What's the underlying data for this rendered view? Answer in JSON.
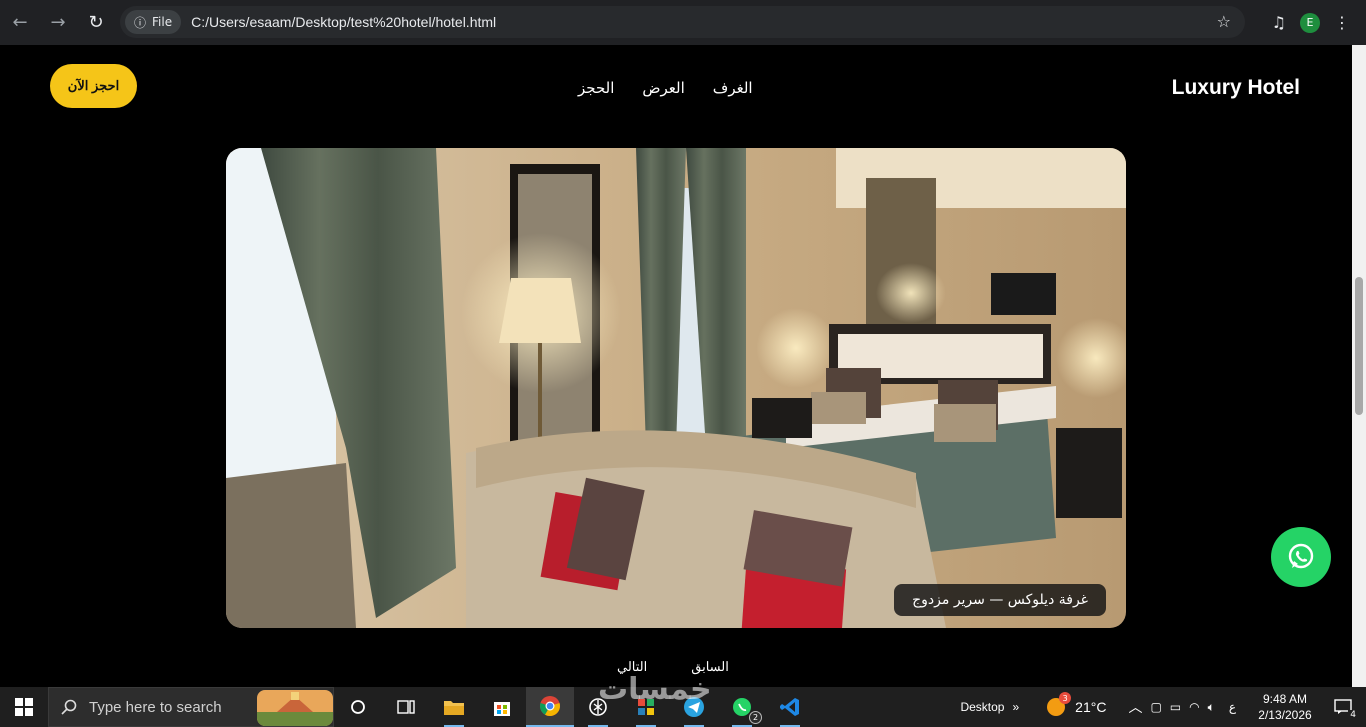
{
  "browser": {
    "site_chip": "File",
    "url": "C:/Users/esaam/Desktop/test%20hotel/hotel.html",
    "profile_initial": "E"
  },
  "site": {
    "logo": "Luxury Hotel",
    "nav": [
      "الغرف",
      "العرض",
      "الحجز"
    ],
    "book_button": "احجز الآن",
    "slide_caption": "غرفة ديلوكس — سرير مزدوج",
    "prev_label": "السابق",
    "next_label": "التالي"
  },
  "colors": {
    "accent_yellow": "#f5c518",
    "whatsapp_green": "#25d366"
  },
  "taskbar": {
    "search_placeholder": "Type here to search",
    "desktop_label": "Desktop",
    "temperature": "21°C",
    "weather_badge": "3",
    "lang": "ع",
    "time": "9:48 AM",
    "date": "2/13/2026",
    "notification_count": "4",
    "whatsapp_badge": "2"
  },
  "watermark": "خمسات"
}
